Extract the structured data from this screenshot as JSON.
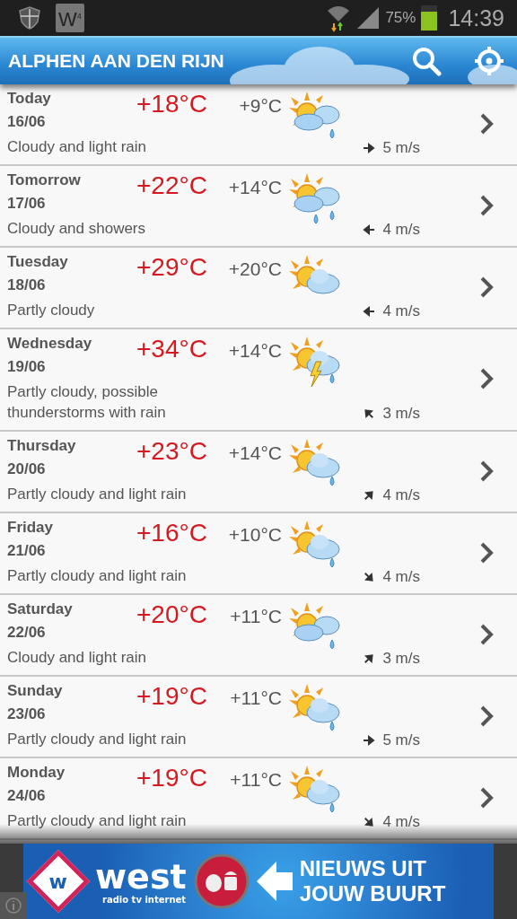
{
  "status_bar": {
    "battery_text": "75%",
    "time": "14:39",
    "notification_badge": "W",
    "notification_sup": "4"
  },
  "header": {
    "title": "ALPHEN AAN DEN RIJN"
  },
  "days": [
    {
      "day": "Today",
      "date": "16/06",
      "high": "+18°C",
      "low": "+9°C",
      "description": "Cloudy and light rain",
      "weather_icon": {
        "kind": "cloudrain"
      },
      "wind_arrow": {
        "kind": "east"
      },
      "wind": "5 m/s"
    },
    {
      "day": "Tomorrow",
      "date": "17/06",
      "high": "+22°C",
      "low": "+14°C",
      "description": "Cloudy and showers",
      "weather_icon": {
        "kind": "showers"
      },
      "wind_arrow": {
        "kind": "west"
      },
      "wind": "4 m/s"
    },
    {
      "day": "Tuesday",
      "date": "18/06",
      "high": "+29°C",
      "low": "+20°C",
      "description": "Partly cloudy",
      "weather_icon": {
        "kind": "partly"
      },
      "wind_arrow": {
        "kind": "west"
      },
      "wind": "4 m/s"
    },
    {
      "day": "Wednesday",
      "date": "19/06",
      "high": "+34°C",
      "low": "+14°C",
      "description": "Partly cloudy, possible thunderstorms with rain",
      "weather_icon": {
        "kind": "thunder"
      },
      "wind_arrow": {
        "kind": "northwest"
      },
      "wind": "3 m/s"
    },
    {
      "day": "Thursday",
      "date": "20/06",
      "high": "+23°C",
      "low": "+14°C",
      "description": "Partly cloudy and light rain",
      "weather_icon": {
        "kind": "partlyrain"
      },
      "wind_arrow": {
        "kind": "northeast"
      },
      "wind": "4 m/s"
    },
    {
      "day": "Friday",
      "date": "21/06",
      "high": "+16°C",
      "low": "+10°C",
      "description": "Partly cloudy and light rain",
      "weather_icon": {
        "kind": "partlyrain"
      },
      "wind_arrow": {
        "kind": "southeast"
      },
      "wind": "4 m/s"
    },
    {
      "day": "Saturday",
      "date": "22/06",
      "high": "+20°C",
      "low": "+11°C",
      "description": "Cloudy and light rain",
      "weather_icon": {
        "kind": "cloudrain"
      },
      "wind_arrow": {
        "kind": "northeast"
      },
      "wind": "3 m/s"
    },
    {
      "day": "Sunday",
      "date": "23/06",
      "high": "+19°C",
      "low": "+11°C",
      "description": "Partly cloudy and light rain",
      "weather_icon": {
        "kind": "partlyrain"
      },
      "wind_arrow": {
        "kind": "east"
      },
      "wind": "5 m/s"
    },
    {
      "day": "Monday",
      "date": "24/06",
      "high": "+19°C",
      "low": "+11°C",
      "description": "Partly cloudy and light rain",
      "weather_icon": {
        "kind": "partlyrain"
      },
      "wind_arrow": {
        "kind": "southeast"
      },
      "wind": "4 m/s"
    }
  ],
  "ad": {
    "logo_letter": "w",
    "brand": "west",
    "tagline": "radio tv internet",
    "headline_1": "NIEUWS UIT",
    "headline_2": "JOUW BUURT"
  }
}
